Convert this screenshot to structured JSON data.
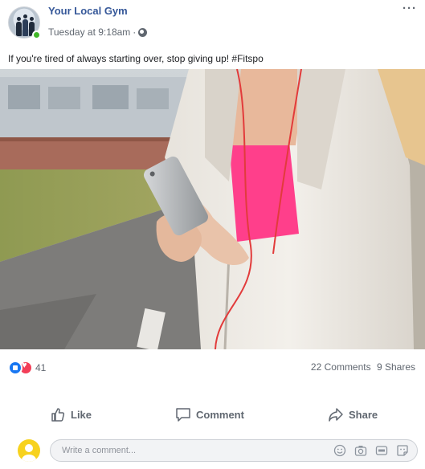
{
  "post": {
    "page_name": "Your Local Gym",
    "timestamp": "Tuesday at 9:18am",
    "meta_separator": "·",
    "text": "If you're tired of always starting over, stop giving up! #Fitspo",
    "more_label": "···"
  },
  "reactions": {
    "count": "41",
    "comments": "22 Comments",
    "shares": "9 Shares"
  },
  "actions": {
    "like_label": "Like",
    "comment_label": "Comment",
    "share_label": "Share"
  },
  "composer": {
    "placeholder": "Write a comment..."
  },
  "colors": {
    "link_blue": "#365899",
    "like_blue": "#1877f2",
    "love_red": "#f33e58",
    "online_green": "#42b72a"
  }
}
